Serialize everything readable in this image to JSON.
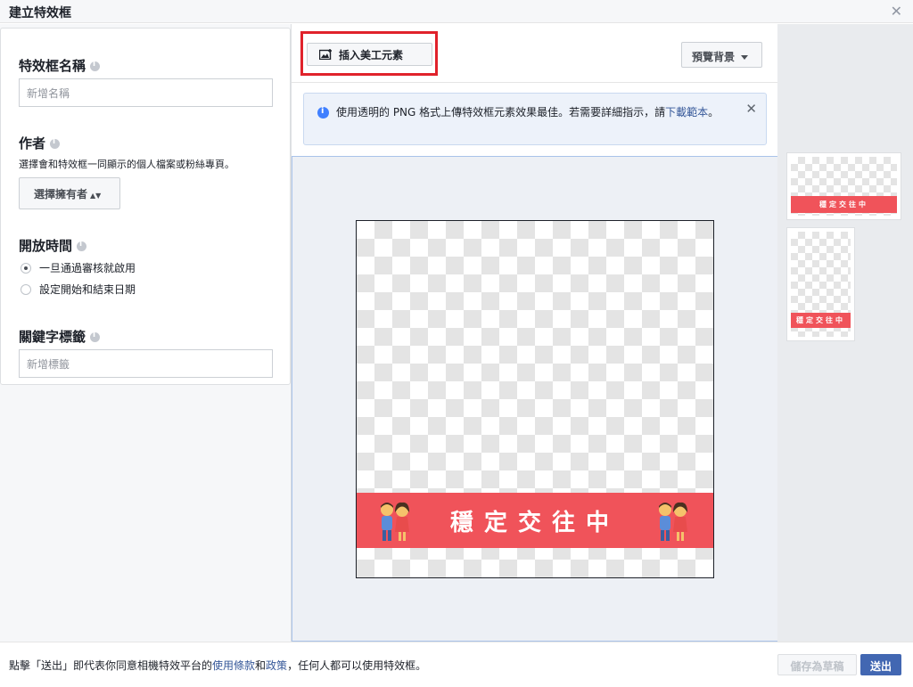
{
  "dialog": {
    "title": "建立特效框",
    "close_icon": "close-icon"
  },
  "form": {
    "name": {
      "label": "特效框名稱",
      "placeholder": "新增名稱"
    },
    "author": {
      "label": "作者",
      "helper": "選擇會和特效框一同顯示的個人檔案或粉絲專頁。",
      "select_label": "選擇擁有者"
    },
    "schedule": {
      "label": "開放時間",
      "options": [
        {
          "label": "一旦通過審核就啟用",
          "selected": true
        },
        {
          "label": "設定開始和結束日期",
          "selected": false
        }
      ]
    },
    "keywords": {
      "label": "關鍵字標籤",
      "placeholder": "新增標籤"
    }
  },
  "toolbar": {
    "insert_label": "插入美工元素",
    "preview_label": "預覽背景"
  },
  "notice": {
    "text_before": "使用透明的 PNG 格式上傳特效框元素效果最佳。若需要詳細指示，請",
    "link": "下載範本",
    "text_after": "。"
  },
  "frame": {
    "banner_text": "穩定交往中"
  },
  "thumbnails": [
    {
      "shape": "landscape",
      "banner_text": "穩定交往中"
    },
    {
      "shape": "portrait",
      "banner_text": "穩定交往中"
    }
  ],
  "footer": {
    "legal_prefix": "點擊「送出」即代表你同意相機特效平台的",
    "terms_link": "使用條款",
    "and": "和",
    "policy_link": "政策",
    "legal_suffix": "，任何人都可以使用特效框。",
    "draft_label": "儲存為草稿",
    "send_label": "送出"
  },
  "colors": {
    "accent": "#4267b2",
    "banner": "#f0535a",
    "highlight": "#e0222b"
  }
}
